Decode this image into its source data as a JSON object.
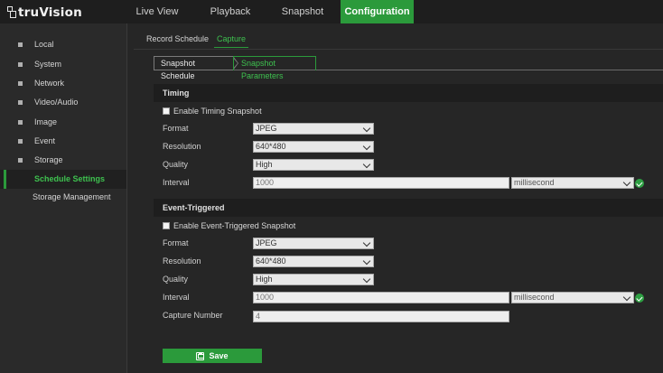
{
  "brand": {
    "name": "truVision"
  },
  "nav": {
    "tabs": [
      {
        "label": "Live View"
      },
      {
        "label": "Playback"
      },
      {
        "label": "Snapshot"
      },
      {
        "label": "Configuration"
      }
    ],
    "active": "Configuration"
  },
  "sidebar": {
    "items": [
      {
        "label": "Local"
      },
      {
        "label": "System"
      },
      {
        "label": "Network"
      },
      {
        "label": "Video/Audio"
      },
      {
        "label": "Image"
      },
      {
        "label": "Event"
      },
      {
        "label": "Storage"
      },
      {
        "label": "Schedule Settings"
      },
      {
        "label": "Storage Management"
      }
    ],
    "active": "Schedule Settings"
  },
  "subtabs": [
    {
      "label": "Record Schedule"
    },
    {
      "label": "Capture"
    }
  ],
  "breadcrumb": [
    {
      "label": "Snapshot Schedule"
    },
    {
      "label": "Snapshot Parameters"
    }
  ],
  "timing": {
    "title": "Timing",
    "enable_label": "Enable Timing Snapshot",
    "format_label": "Format",
    "format_value": "JPEG",
    "resolution_label": "Resolution",
    "resolution_value": "640*480",
    "quality_label": "Quality",
    "quality_value": "High",
    "interval_label": "Interval",
    "interval_value": "1000",
    "interval_unit": "millisecond"
  },
  "event": {
    "title": "Event-Triggered",
    "enable_label": "Enable Event-Triggered Snapshot",
    "format_label": "Format",
    "format_value": "JPEG",
    "resolution_label": "Resolution",
    "resolution_value": "640*480",
    "quality_label": "Quality",
    "quality_value": "High",
    "interval_label": "Interval",
    "interval_value": "1000",
    "interval_unit": "millisecond",
    "capture_number_label": "Capture Number",
    "capture_number_value": "4"
  },
  "save_label": "Save",
  "colors": {
    "accent": "#2b9a3b",
    "background": "#262626",
    "header": "#1e1e1e"
  }
}
